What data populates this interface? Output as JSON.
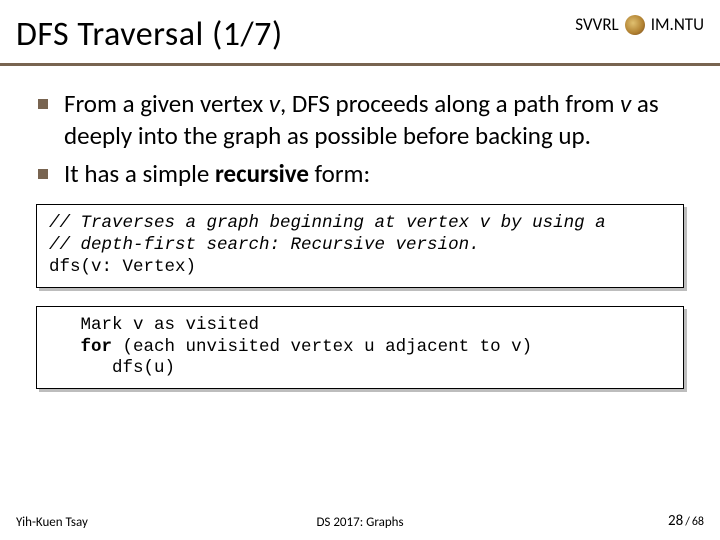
{
  "header": {
    "title": "DFS Traversal (1/7)",
    "org_left": "SVVRL",
    "org_at": "@",
    "org_right": "IM.NTU"
  },
  "bullets": [
    {
      "pre1": "From a given vertex ",
      "v1": "v",
      "mid1": ", DFS proceeds along a path from ",
      "v2": "v",
      "mid2": " as deeply into the graph as possible before backing up."
    },
    {
      "pre1": "It has a simple ",
      "bold1": "recursive",
      "post1": " form:"
    }
  ],
  "code1": {
    "c1": "// Traverses a graph beginning at vertex v by using a",
    "c2": "// depth-first search: Recursive version.",
    "l1": "dfs(v: Vertex)"
  },
  "code2": {
    "l1": "   Mark v as visited",
    "l2a": "   ",
    "l2b": "for",
    "l2c": " (each unvisited vertex u adjacent to v)",
    "l3": "      dfs(u)"
  },
  "footer": {
    "left": "Yih-Kuen Tsay",
    "center": "DS 2017: Graphs",
    "page_current": "28",
    "page_sep": " / ",
    "page_total": "68"
  }
}
